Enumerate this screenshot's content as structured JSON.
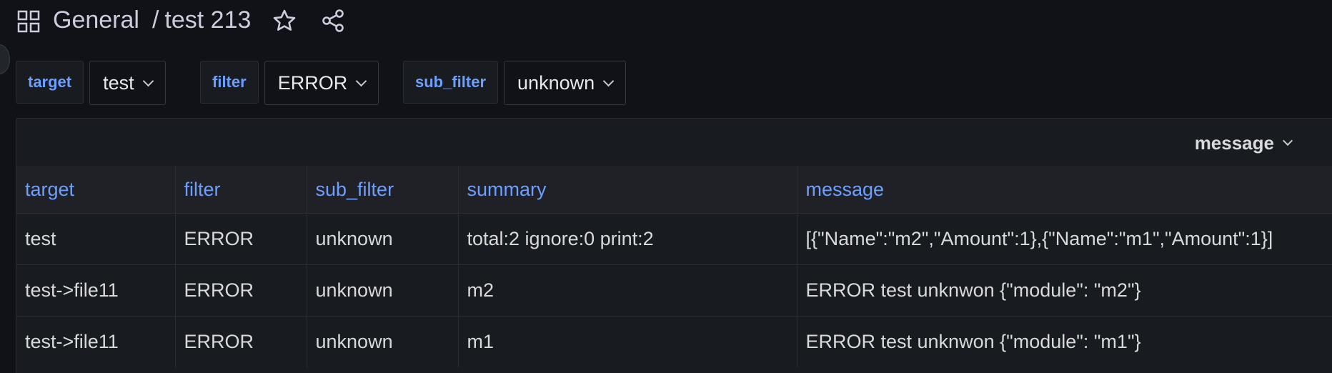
{
  "header": {
    "folder": "General",
    "separator": "/",
    "dashboard": "test 213",
    "icons": [
      "grid-icon",
      "star-icon",
      "share-icon"
    ]
  },
  "variables": [
    {
      "label": "target",
      "value": "test"
    },
    {
      "label": "filter",
      "value": "ERROR"
    },
    {
      "label": "sub_filter",
      "value": "unknown"
    }
  ],
  "panel": {
    "field_selector": "message",
    "table": {
      "columns": [
        "target",
        "filter",
        "sub_filter",
        "summary",
        "message"
      ],
      "rows": [
        [
          "test",
          "ERROR",
          "unknown",
          "total:2 ignore:0 print:2",
          "[{\"Name\":\"m2\",\"Amount\":1},{\"Name\":\"m1\",\"Amount\":1}]"
        ],
        [
          "test->file11",
          "ERROR",
          "unknown",
          "m2",
          "ERROR test unknwon {\"module\": \"m2\"}"
        ],
        [
          "test->file11",
          "ERROR",
          "unknown",
          "m1",
          "ERROR test unknwon {\"module\": \"m1\"}"
        ]
      ]
    }
  },
  "colors": {
    "background": "#111217",
    "panel": "#181b1f",
    "accent": "#6e9fff",
    "text": "#d8d9da"
  }
}
